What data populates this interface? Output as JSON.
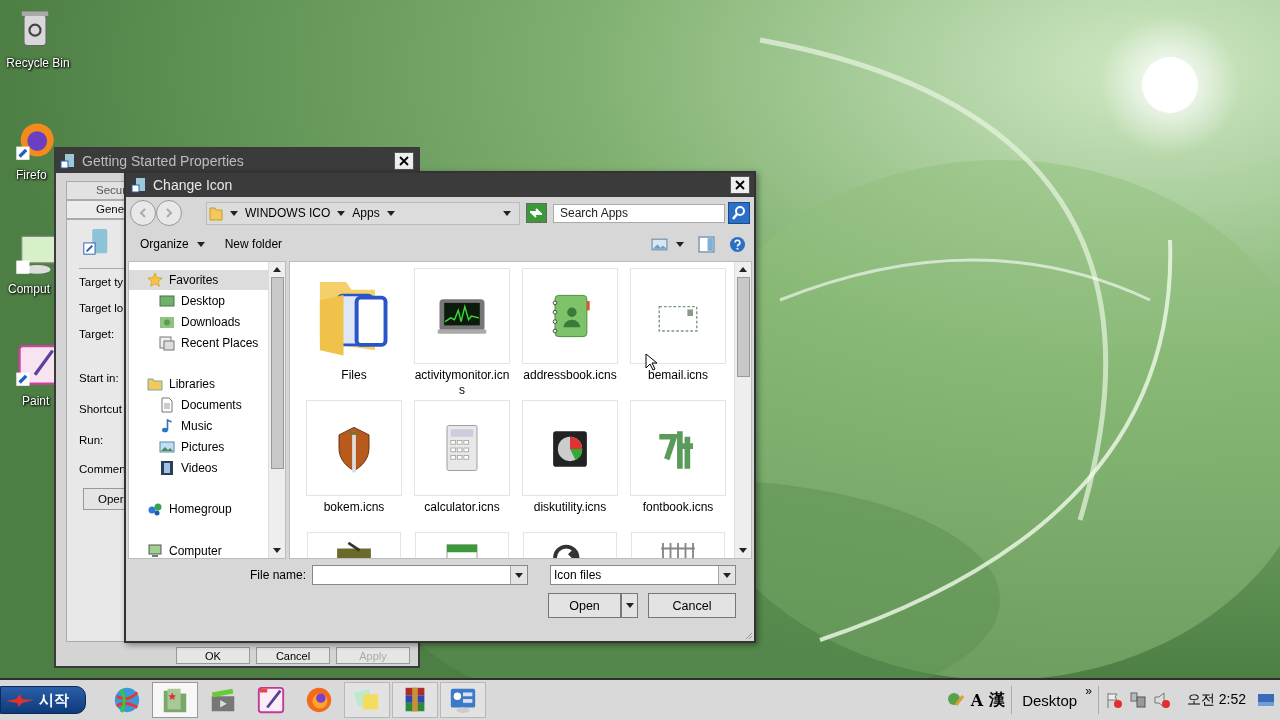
{
  "desktop_icons": [
    {
      "label": "Recycle Bin"
    },
    {
      "label": "Firefo"
    },
    {
      "label": "Comput"
    },
    {
      "label": "Paint"
    }
  ],
  "background_window": {
    "title": "Getting Started Properties",
    "tabs": [
      {
        "label": "Secur",
        "selected": false
      },
      {
        "label": "Gene",
        "selected": true
      }
    ],
    "labels": [
      "Target ty",
      "Target lo",
      "Target:",
      "Start in:",
      "Shortcut",
      "Run:",
      "Commen"
    ],
    "open_button": "Oper",
    "buttons": [
      {
        "label": "OK",
        "disabled": false
      },
      {
        "label": "Cancel",
        "disabled": false
      },
      {
        "label": "Apply",
        "disabled": true
      }
    ]
  },
  "dialog": {
    "title": "Change Icon",
    "breadcrumbs": [
      "WINDOWS ICO",
      "Apps"
    ],
    "search": {
      "placeholder": "Search Apps"
    },
    "toolbar": {
      "organize": "Organize",
      "new_folder": "New folder"
    },
    "sidebar": [
      {
        "label": "Favorites",
        "selected": true,
        "children": [
          {
            "label": "Desktop",
            "selected": false
          },
          {
            "label": "Downloads",
            "selected": false
          },
          {
            "label": "Recent Places",
            "selected": false
          }
        ]
      },
      {
        "label": "Libraries",
        "selected": false,
        "children": [
          {
            "label": "Documents",
            "selected": false
          },
          {
            "label": "Music",
            "selected": false
          },
          {
            "label": "Pictures",
            "selected": false
          },
          {
            "label": "Videos",
            "selected": false
          }
        ]
      },
      {
        "label": "Homegroup",
        "selected": false
      },
      {
        "label": "Computer",
        "selected": false
      }
    ],
    "files": [
      {
        "label": "Files"
      },
      {
        "label": "activitymonitor.icns"
      },
      {
        "label": "addressbook.icns"
      },
      {
        "label": "bemail.icns"
      },
      {
        "label": "bokem.icns"
      },
      {
        "label": "calculator.icns"
      },
      {
        "label": "diskutility.icns"
      },
      {
        "label": "fontbook.icns"
      }
    ],
    "file_name": {
      "label": "File name:"
    },
    "file_type": "Icon files",
    "buttons": {
      "open": "Open",
      "cancel": "Cancel"
    }
  },
  "taskbar": {
    "start": "시작",
    "apps": [
      {
        "running": false,
        "selected": false
      },
      {
        "running": true,
        "selected": true
      },
      {
        "running": false,
        "selected": false
      },
      {
        "running": false,
        "selected": false
      },
      {
        "running": false,
        "selected": false
      },
      {
        "running": true,
        "selected": false
      },
      {
        "running": true,
        "selected": false
      },
      {
        "running": true,
        "selected": false
      }
    ],
    "ime": [
      "A",
      "漢"
    ],
    "toolbar": "Desktop",
    "overflow": "»",
    "clock": "오전 2:52"
  }
}
